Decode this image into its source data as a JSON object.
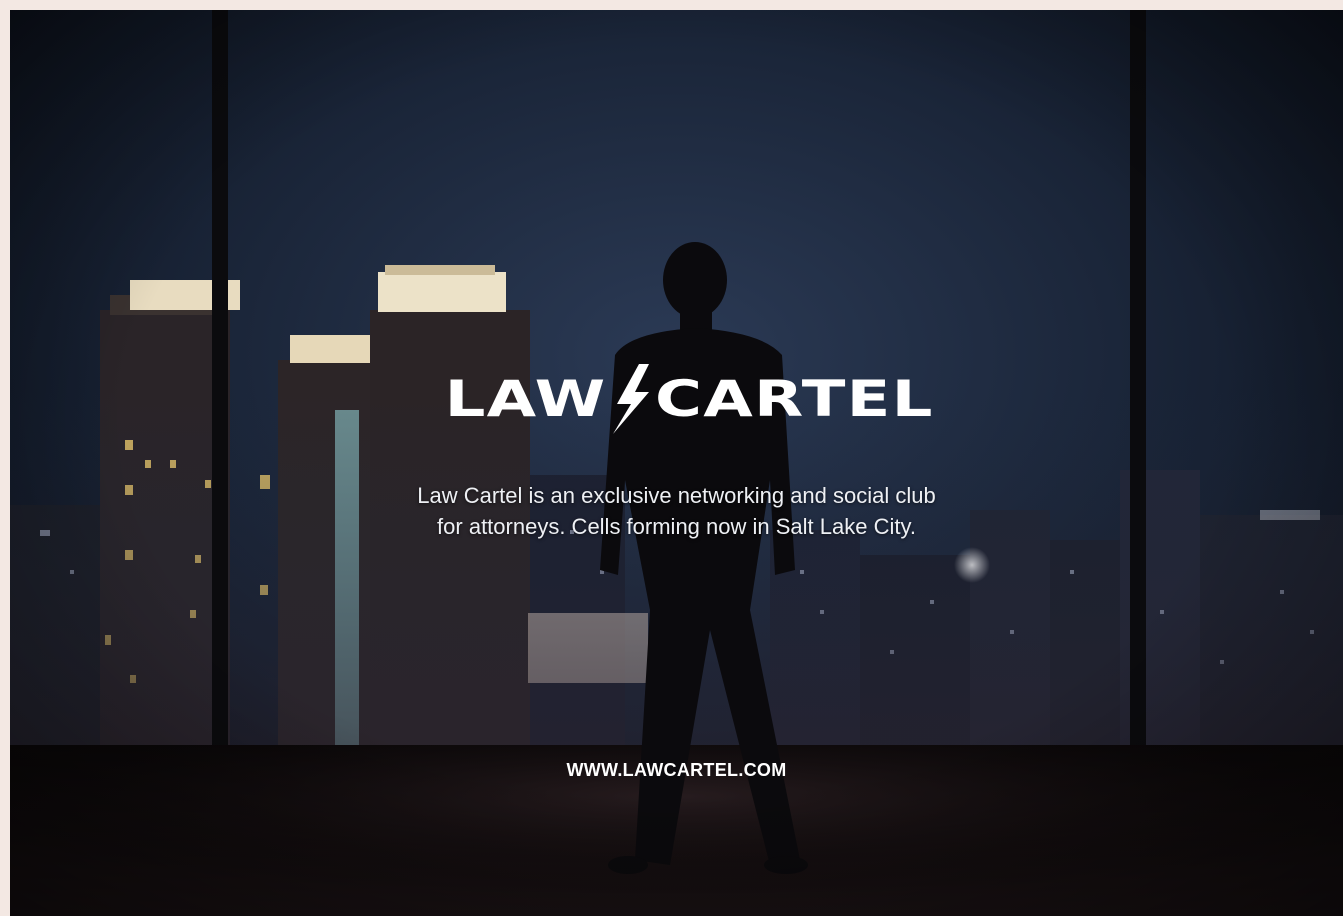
{
  "brand": {
    "name_left": "LAW",
    "name_right": "CARTEL",
    "logo_icon": "lightning-bolt-icon"
  },
  "tagline": {
    "line1": "Law Cartel is an exclusive networking and social club",
    "line2": "for attorneys. Cells forming now in Salt Lake City."
  },
  "website": "WWW.LAWCARTEL.COM",
  "colors": {
    "page_background": "#f3e8e3",
    "sky": "#1b2638",
    "text": "#ffffff"
  }
}
